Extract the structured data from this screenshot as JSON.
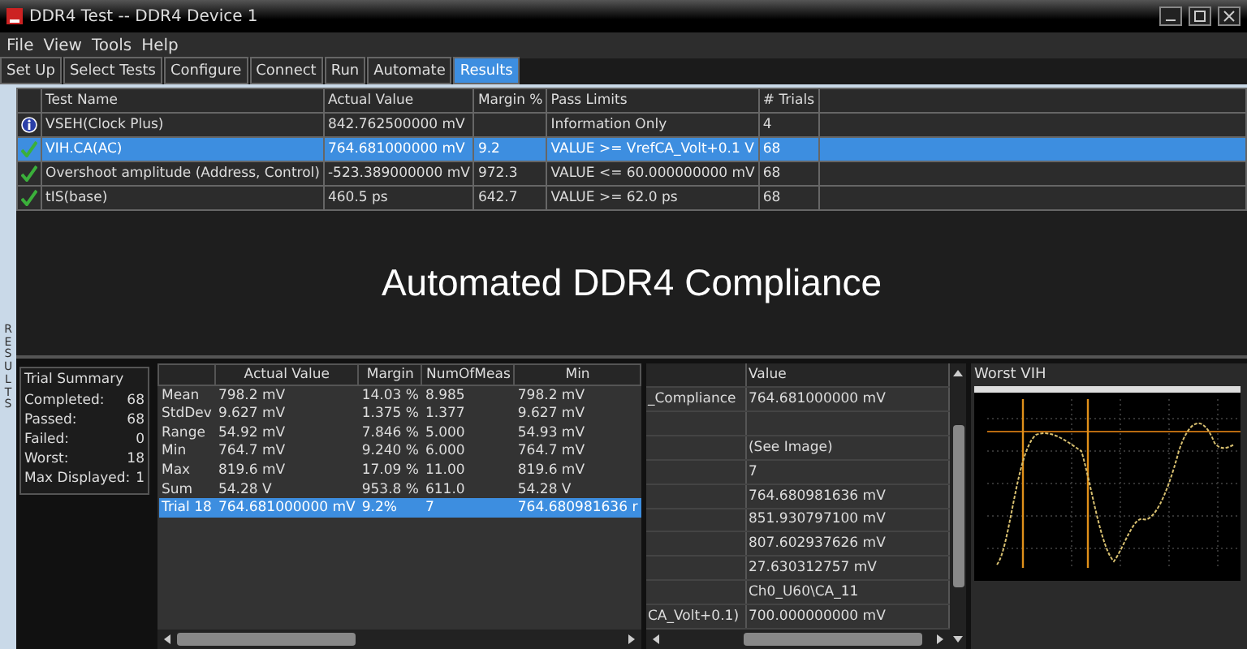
{
  "window": {
    "title": "DDR4 Test -- DDR4 Device 1"
  },
  "menu": [
    "File",
    "View",
    "Tools",
    "Help"
  ],
  "tabs": [
    {
      "label": "Set Up",
      "selected": false
    },
    {
      "label": "Select Tests",
      "selected": false
    },
    {
      "label": "Configure",
      "selected": false
    },
    {
      "label": "Connect",
      "selected": false
    },
    {
      "label": "Run",
      "selected": false
    },
    {
      "label": "Automate",
      "selected": false
    },
    {
      "label": "Results",
      "selected": true
    }
  ],
  "side_label": "RESULTS",
  "results_table": {
    "columns": [
      "Test Name",
      "Actual Value",
      "Margin %",
      "Pass Limits",
      "# Trials"
    ],
    "rows": [
      {
        "kind": "info",
        "selected": false,
        "cells": [
          "VSEH(Clock Plus)",
          "842.762500000 mV",
          "",
          "Information Only",
          "4"
        ]
      },
      {
        "kind": "pass",
        "selected": true,
        "cells": [
          "VIH.CA(AC)",
          "764.681000000 mV",
          "9.2",
          "VALUE >= VrefCA_Volt+0.1 V",
          "68"
        ]
      },
      {
        "kind": "pass",
        "selected": false,
        "cells": [
          "Overshoot amplitude (Address, Control)",
          "-523.389000000 mV",
          "972.3",
          "VALUE <= 60.000000000 mV",
          "68"
        ]
      },
      {
        "kind": "pass",
        "selected": false,
        "cells": [
          "tIS(base)",
          "460.5 ps",
          "642.7",
          "VALUE >= 62.0 ps",
          "68"
        ]
      }
    ]
  },
  "overlay_caption": "Automated DDR4 Compliance",
  "trial_summary": {
    "title": "Trial Summary",
    "items": [
      {
        "label": "Completed:",
        "value": "68"
      },
      {
        "label": "Passed:",
        "value": "68"
      },
      {
        "label": "Failed:",
        "value": "0"
      },
      {
        "label": "Worst:",
        "value": "18"
      },
      {
        "label": "Max Displayed:",
        "value": "1"
      }
    ]
  },
  "stats_table": {
    "columns": [
      "",
      "Actual Value",
      "Margin",
      "NumOfMeas",
      "Min"
    ],
    "rows": [
      {
        "selected": false,
        "cells": [
          "Mean",
          "798.2 mV",
          "14.03 %",
          "8.985",
          "798.2 mV"
        ]
      },
      {
        "selected": false,
        "cells": [
          "StdDev",
          "9.627 mV",
          "1.375 %",
          "1.377",
          "9.627 mV"
        ]
      },
      {
        "selected": false,
        "cells": [
          "Range",
          "54.92 mV",
          "7.846 %",
          "5.000",
          "54.93 mV"
        ]
      },
      {
        "selected": false,
        "cells": [
          "Min",
          "764.7 mV",
          "9.240 %",
          "6.000",
          "764.7 mV"
        ]
      },
      {
        "selected": false,
        "cells": [
          "Max",
          "819.6 mV",
          "17.09 %",
          "11.00",
          "819.6 mV"
        ]
      },
      {
        "selected": false,
        "cells": [
          "Sum",
          "54.28 V",
          "953.8 %",
          "611.0",
          "54.28 V"
        ]
      },
      {
        "selected": true,
        "cells": [
          "Trial 18",
          "764.681000000 mV",
          "9.2%",
          "7",
          "764.680981636 r"
        ]
      }
    ]
  },
  "value_table": {
    "columns": [
      "",
      "Value"
    ],
    "rows": [
      [
        "_Compliance",
        "764.681000000 mV"
      ],
      [
        "",
        ""
      ],
      [
        "",
        "(See Image)"
      ],
      [
        "",
        "7"
      ],
      [
        "",
        "764.680981636 mV"
      ],
      [
        "",
        "851.930797100 mV"
      ],
      [
        "",
        "807.602937626 mV"
      ],
      [
        "",
        "27.630312757 mV"
      ],
      [
        "",
        "Ch0_U60\\CA_11"
      ],
      [
        "CA_Volt+0.1)",
        "700.000000000 mV"
      ]
    ]
  },
  "worst_panel": {
    "title": "Worst VIH"
  }
}
